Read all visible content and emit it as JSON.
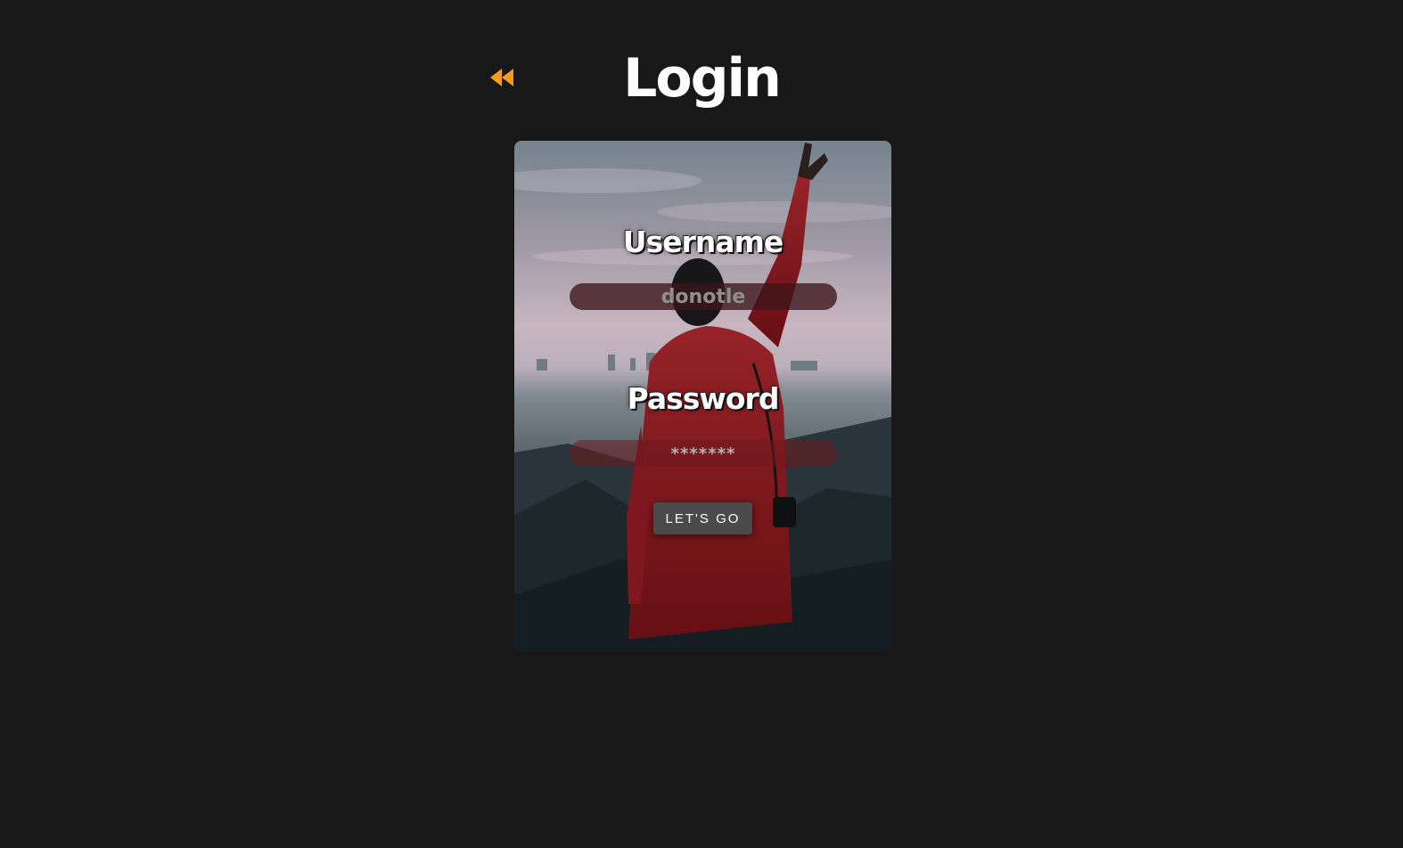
{
  "header": {
    "back_icon": "rewind-icon",
    "title": "Login"
  },
  "form": {
    "username_label": "Username",
    "username_value": "donotle",
    "password_label": "Password",
    "password_value": "*******",
    "submit_label": "LET'S GO"
  },
  "colors": {
    "background": "#181818",
    "accent": "#f29b1f",
    "button": "#4a4a4a"
  }
}
